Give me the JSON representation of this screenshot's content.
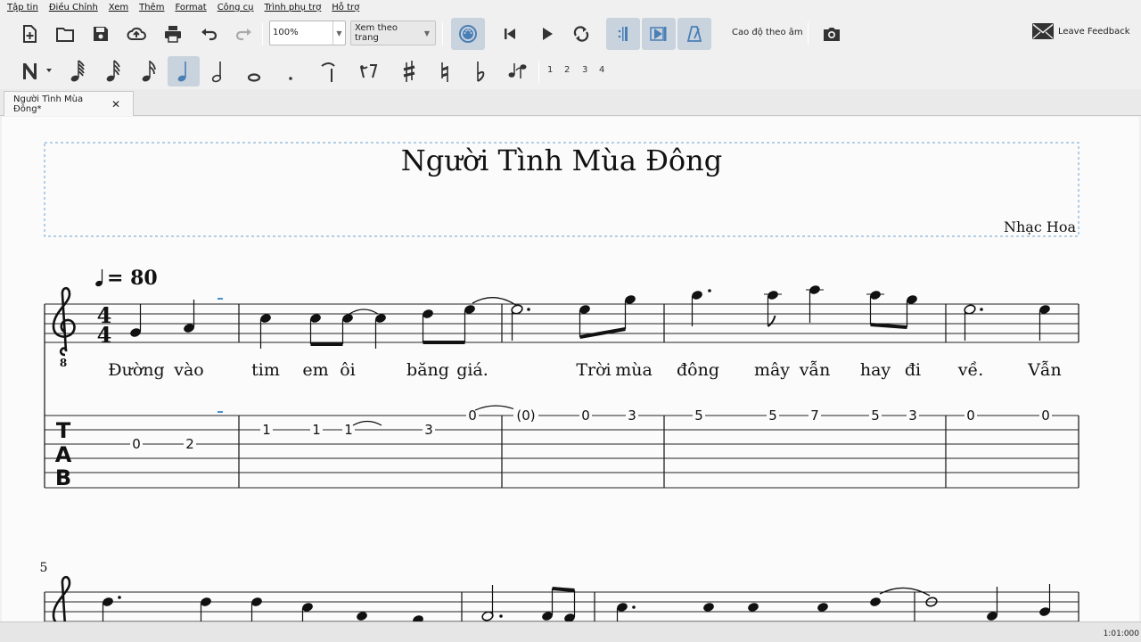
{
  "menu": [
    "Tập tin",
    "Điều Chỉnh",
    "Xem",
    "Thêm",
    "Format",
    "Công cụ",
    "Trình phụ trợ",
    "Hỗ trợ"
  ],
  "toolbar": {
    "zoom_value": "100%",
    "view_mode": "Xem theo trang",
    "pitch_label": "Cao độ theo âm",
    "feedback_label": "Leave Feedback"
  },
  "note_toolbar": {
    "voices": [
      "1",
      "2",
      "3",
      "4"
    ]
  },
  "tab": {
    "title": "Người Tình Mùa Đông*",
    "close": "✕"
  },
  "score": {
    "title": "Người Tình Mùa Đông",
    "composer": "Nhạc Hoa",
    "tempo": "= 80",
    "time_sig_top": "4",
    "time_sig_bottom": "4",
    "clef_octave": "8",
    "tab_letters": [
      "T",
      "A",
      "B"
    ],
    "measure_number_2": "5",
    "lyrics": [
      "Đường",
      "vào",
      "tim",
      "em",
      "ôi",
      "băng",
      "giá.",
      "Trời",
      "mùa",
      "đông",
      "mây",
      "vẫn",
      "hay",
      "đi",
      "về.",
      "Vẫn"
    ],
    "tab_numbers": [
      "0",
      "2",
      "1",
      "1",
      "1",
      "3",
      "0",
      "(0)",
      "0",
      "3",
      "5",
      "5",
      "7",
      "5",
      "3",
      "0",
      "0"
    ]
  },
  "status": {
    "time": "1:01:000"
  }
}
